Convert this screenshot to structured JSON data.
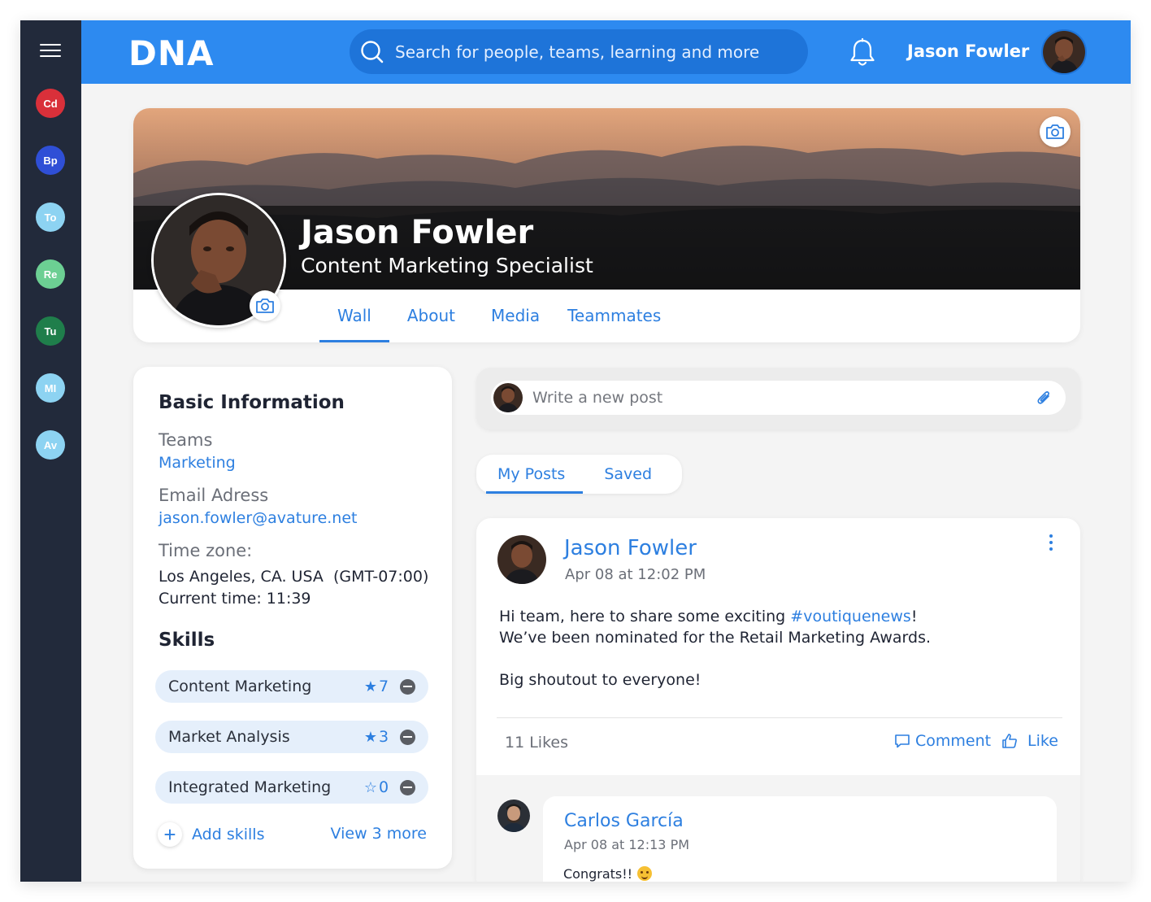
{
  "app": {
    "logo": "DNA",
    "brand_color": "#2d8af0",
    "sidebar_color": "#222a3b"
  },
  "rail": {
    "items": [
      {
        "initials": "Cd",
        "color": "#d9303a"
      },
      {
        "initials": "Bp",
        "color": "#2f4fd6"
      },
      {
        "initials": "To",
        "color": "#8dd3f2"
      },
      {
        "initials": "Re",
        "color": "#6ccf93"
      },
      {
        "initials": "Tu",
        "color": "#1f7e4b"
      },
      {
        "initials": "MI",
        "color": "#8dd3f2"
      },
      {
        "initials": "Av",
        "color": "#8dd3f2"
      }
    ]
  },
  "header": {
    "search_placeholder": "Search for people, teams, learning and more",
    "user_name": "Jason Fowler"
  },
  "profile": {
    "name": "Jason Fowler",
    "title": "Content Marketing Specialist",
    "tabs": [
      "Wall",
      "About",
      "Media",
      "Teammates"
    ],
    "active_tab": "Wall"
  },
  "basic_info": {
    "heading": "Basic Information",
    "teams_label": "Teams",
    "teams_value": "Marketing",
    "email_label": "Email Adress",
    "email_value": "jason.fowler@avature.net",
    "timezone_label": "Time zone:",
    "timezone_value": "Los Angeles, CA. USA  (GMT-07:00)",
    "current_time": "Current time: 11:39"
  },
  "skills": {
    "heading": "Skills",
    "items": [
      {
        "name": "Content Marketing",
        "count": "7",
        "starred": true
      },
      {
        "name": "Market Analysis",
        "count": "3",
        "starred": true
      },
      {
        "name": "Integrated Marketing",
        "count": "0",
        "starred": false
      }
    ],
    "add_label": "Add skills",
    "view_more_label": "View 3 more"
  },
  "new_post": {
    "placeholder": "Write a new post"
  },
  "post_tabs": [
    "My Posts",
    "Saved"
  ],
  "post": {
    "author": "Jason Fowler",
    "date": "Apr 08 at 12:02 PM",
    "line1_prefix": "Hi team, here to share some exciting ",
    "hashtag": "#voutiquenews",
    "line1_suffix": "!",
    "line2": "We’ve been nominated for the Retail Marketing Awards.",
    "line3": "Big shoutout to everyone!",
    "likes": "11 Likes",
    "comment_label": "Comment",
    "like_label": "Like"
  },
  "comment": {
    "author": "Carlos García",
    "date": "Apr 08 at 12:13 PM",
    "text": "Congrats!!"
  }
}
